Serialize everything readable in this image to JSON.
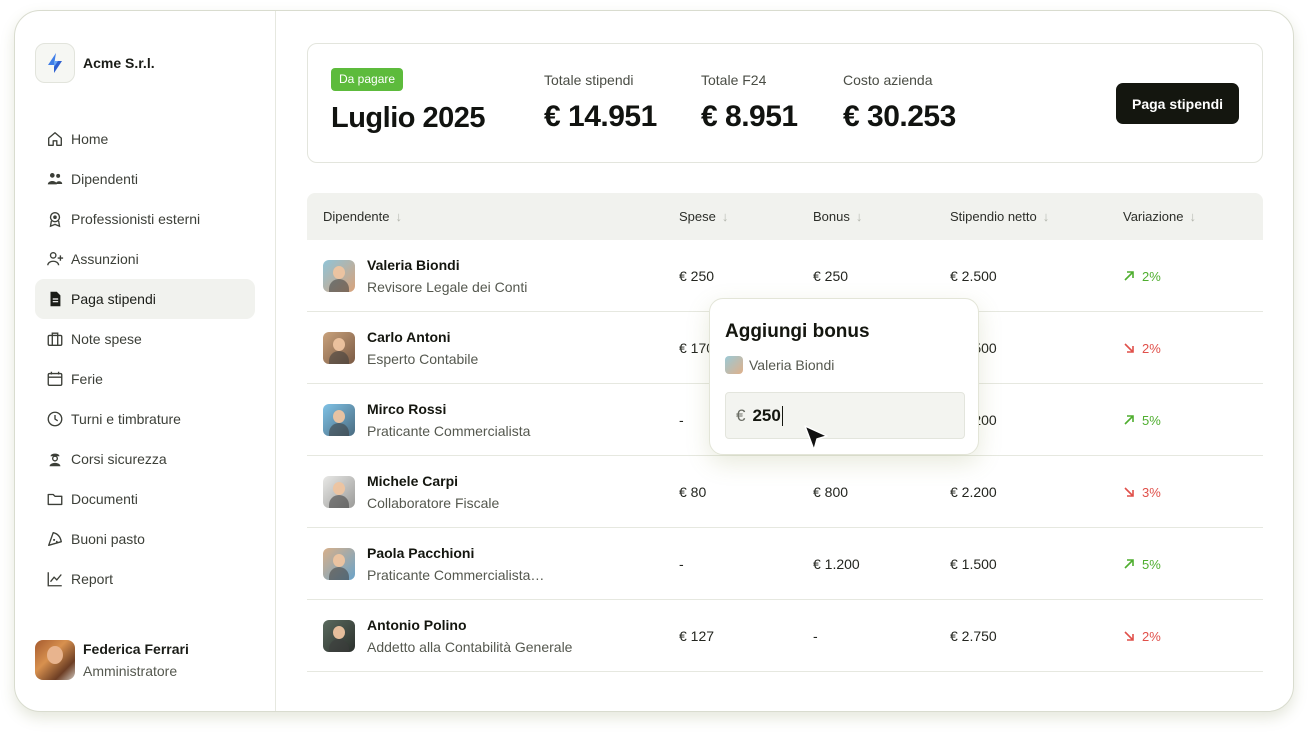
{
  "company": {
    "name": "Acme S.r.l."
  },
  "nav": [
    {
      "label": "Home",
      "icon": "home-icon"
    },
    {
      "label": "Dipendenti",
      "icon": "people-icon"
    },
    {
      "label": "Professionisti esterni",
      "icon": "badge-icon"
    },
    {
      "label": "Assunzioni",
      "icon": "user-plus-icon"
    },
    {
      "label": "Paga stipendi",
      "icon": "document-icon",
      "active": true
    },
    {
      "label": "Note spese",
      "icon": "briefcase-icon"
    },
    {
      "label": "Ferie",
      "icon": "calendar-icon"
    },
    {
      "label": "Turni e timbrature",
      "icon": "clock-icon"
    },
    {
      "label": "Corsi sicurezza",
      "icon": "worker-icon"
    },
    {
      "label": "Documenti",
      "icon": "folder-icon"
    },
    {
      "label": "Buoni pasto",
      "icon": "pizza-icon"
    },
    {
      "label": "Report",
      "icon": "chart-icon"
    }
  ],
  "user": {
    "name": "Federica Ferrari",
    "role": "Amministratore"
  },
  "summary": {
    "badge": "Da pagare",
    "period": "Luglio 2025",
    "stats": [
      {
        "label": "Totale stipendi",
        "value": "€ 14.951"
      },
      {
        "label": "Totale F24",
        "value": "€ 8.951"
      },
      {
        "label": "Costo azienda",
        "value": "€ 30.253"
      }
    ],
    "pay_button": "Paga stipendi"
  },
  "table": {
    "columns": [
      "Dipendente",
      "Spese",
      "Bonus",
      "Stipendio netto",
      "Variazione"
    ],
    "rows": [
      {
        "name": "Valeria Biondi",
        "role": "Revisore Legale dei Conti",
        "spese": "€ 250",
        "bonus": "€ 250",
        "netto": "€ 2.500",
        "variazione": "2%",
        "trend": "up"
      },
      {
        "name": "Carlo Antoni",
        "role": "Esperto Contabile",
        "spese": "€ 170",
        "bonus": "",
        "netto": "€ 2.500",
        "variazione": "2%",
        "trend": "down"
      },
      {
        "name": "Mirco Rossi",
        "role": "Praticante Commercialista",
        "spese": "-",
        "bonus": "",
        "netto": "€ 1.200",
        "variazione": "5%",
        "trend": "up"
      },
      {
        "name": "Michele Carpi",
        "role": "Collaboratore Fiscale",
        "spese": "€ 80",
        "bonus": "€ 800",
        "netto": "€ 2.200",
        "variazione": "3%",
        "trend": "down"
      },
      {
        "name": "Paola Pacchioni",
        "role": "Praticante Commercialista…",
        "spese": "-",
        "bonus": "€ 1.200",
        "netto": "€ 1.500",
        "variazione": "5%",
        "trend": "up"
      },
      {
        "name": "Antonio Polino",
        "role": "Addetto alla Contabilità Generale",
        "spese": "€ 127",
        "bonus": "-",
        "netto": "€ 2.750",
        "variazione": "2%",
        "trend": "down"
      }
    ]
  },
  "popover": {
    "title": "Aggiungi bonus",
    "employee": "Valeria Biondi",
    "currency": "€",
    "value": "250"
  },
  "colors": {
    "up": "#4fae2f",
    "down": "#e0504a",
    "badge": "#5dbb3c",
    "primary_button": "#14160f"
  }
}
